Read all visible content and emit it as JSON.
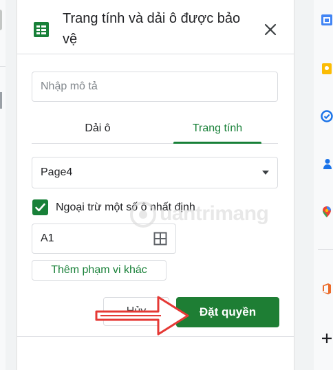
{
  "panel": {
    "title": "Trang tính và dải ô được bảo vệ",
    "description_placeholder": "Nhập mô tả",
    "description_value": ""
  },
  "tabs": [
    {
      "label": "Dải ô",
      "active": false
    },
    {
      "label": "Trang tính",
      "active": true
    }
  ],
  "sheet_select": {
    "value": "Page4"
  },
  "except": {
    "checked": true,
    "label": "Ngoại trừ một số ô nhất định"
  },
  "range_input": {
    "value": "A1"
  },
  "buttons": {
    "add_range": "Thêm phạm vi khác",
    "cancel": "Hủy",
    "set_permissions": "Đặt quyền"
  },
  "watermark": {
    "text": "uantrimang"
  },
  "colors": {
    "accent_green": "#188038",
    "primary_button": "#1e7e34",
    "annotation_red": "#e53935"
  },
  "icons": {
    "header": "google-sheets-icon",
    "close": "close-icon",
    "range_picker": "grid-icon",
    "rail": [
      "google-calendar-icon",
      "google-keep-icon",
      "google-tasks-icon",
      "google-contacts-icon",
      "google-maps-icon",
      "office-addon-icon",
      "add-icon"
    ]
  }
}
